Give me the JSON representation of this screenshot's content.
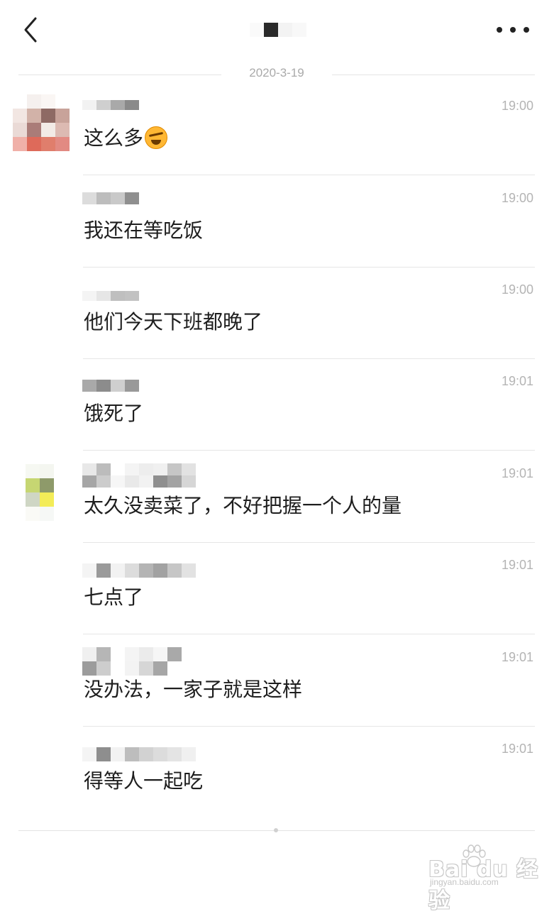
{
  "date_divider": "2020-3-19",
  "watermark": {
    "logo": "Bai du 经验",
    "url": "jingyan.baidu.com"
  },
  "messages": [
    {
      "time": "19:00",
      "text": "这么多",
      "emoji": "laughing-crying-emoji"
    },
    {
      "time": "19:00",
      "text": "我还在等吃饭"
    },
    {
      "time": "19:00",
      "text": "他们今天下班都晚了"
    },
    {
      "time": "19:01",
      "text": "饿死了"
    },
    {
      "time": "19:01",
      "text": "太久没卖菜了，不好把握一个人的量"
    },
    {
      "time": "19:01",
      "text": "七点了"
    },
    {
      "time": "19:01",
      "text": "没办法，一家子就是这样"
    },
    {
      "time": "19:01",
      "text": "得等人一起吃"
    }
  ]
}
